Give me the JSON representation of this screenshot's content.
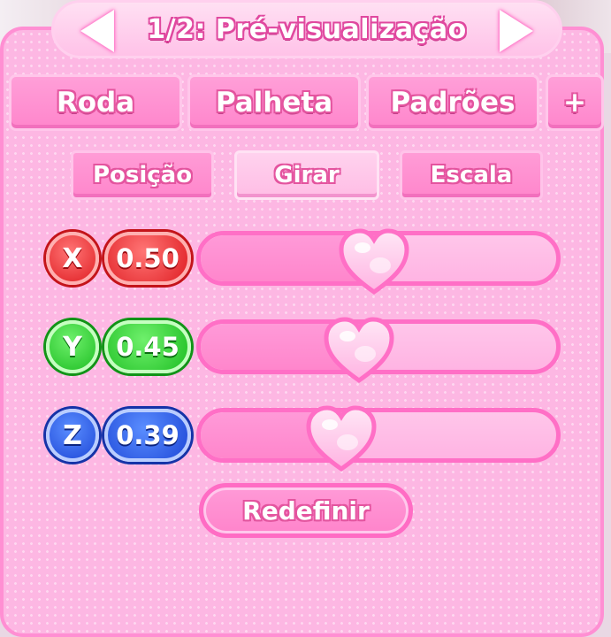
{
  "preview": {
    "title": "1/2: Pré-visualização",
    "prev_icon": "triangle-left-icon",
    "next_icon": "triangle-right-icon"
  },
  "tabs": [
    {
      "label": "Roda"
    },
    {
      "label": "Palheta"
    },
    {
      "label": "Padrões"
    },
    {
      "label": "+"
    }
  ],
  "subtabs": [
    {
      "label": "Posição",
      "active": false
    },
    {
      "label": "Girar",
      "active": true
    },
    {
      "label": "Escala",
      "active": false
    }
  ],
  "axes": [
    {
      "axis": "X",
      "value": "0.50",
      "level": 0.5,
      "color": "#e01f24"
    },
    {
      "axis": "Y",
      "value": "0.45",
      "level": 0.45,
      "color": "#1fbf24"
    },
    {
      "axis": "Z",
      "value": "0.39",
      "level": 0.39,
      "color": "#1f49d8"
    }
  ],
  "slider_thumb_icon": "heart-icon",
  "reset": {
    "label": "Redefinir"
  },
  "colors": {
    "panel": "#fdb7e3",
    "accent": "#ff6fc6"
  }
}
